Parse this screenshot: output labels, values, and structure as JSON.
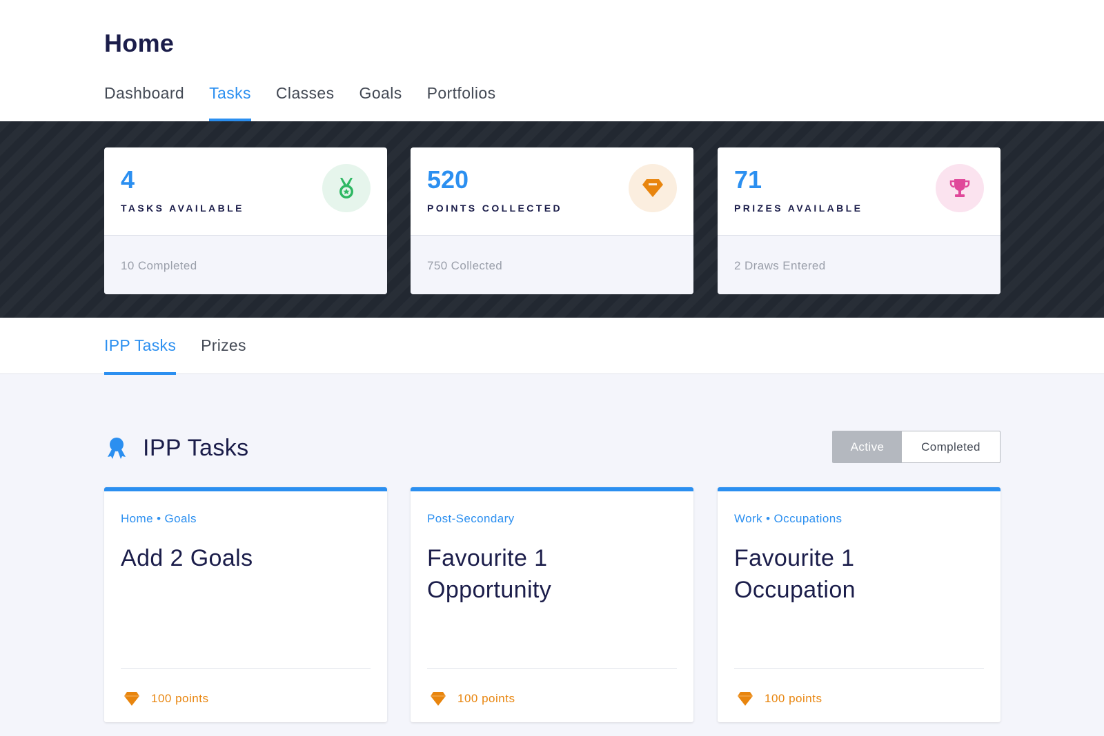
{
  "header": {
    "title": "Home",
    "tabs": [
      {
        "label": "Dashboard",
        "active": false
      },
      {
        "label": "Tasks",
        "active": true
      },
      {
        "label": "Classes",
        "active": false
      },
      {
        "label": "Goals",
        "active": false
      },
      {
        "label": "Portfolios",
        "active": false
      }
    ]
  },
  "stats": [
    {
      "value": "4",
      "label": "TASKS AVAILABLE",
      "sub": "10 Completed",
      "icon": "medal-icon",
      "icon_color": "#2fb863",
      "icon_bg": "#e6f5ec"
    },
    {
      "value": "520",
      "label": "POINTS COLLECTED",
      "sub": "750 Collected",
      "icon": "diamond-icon",
      "icon_color": "#e8850e",
      "icon_bg": "#fbeedf"
    },
    {
      "value": "71",
      "label": "PRIZES AVAILABLE",
      "sub": "2 Draws Entered",
      "icon": "trophy-icon",
      "icon_color": "#e0489a",
      "icon_bg": "#fbe3ef"
    }
  ],
  "sub_tabs": [
    {
      "label": "IPP Tasks",
      "active": true
    },
    {
      "label": "Prizes",
      "active": false
    }
  ],
  "section": {
    "title": "IPP Tasks",
    "icon": "award-ribbon-icon",
    "toggle": {
      "active_label": "Active",
      "completed_label": "Completed",
      "selected": "Active"
    }
  },
  "tasks": [
    {
      "category": "Home • Goals",
      "title": "Add 2 Goals",
      "points": "100 points"
    },
    {
      "category": "Post-Secondary",
      "title": "Favourite 1 Opportunity",
      "points": "100 points"
    },
    {
      "category": "Work • Occupations",
      "title": "Favourite 1 Occupation",
      "points": "100 points"
    }
  ],
  "colors": {
    "accent": "#2b8ff0",
    "dark_band": "#222831",
    "points": "#e8850e",
    "text_dark": "#1b1d4a"
  }
}
